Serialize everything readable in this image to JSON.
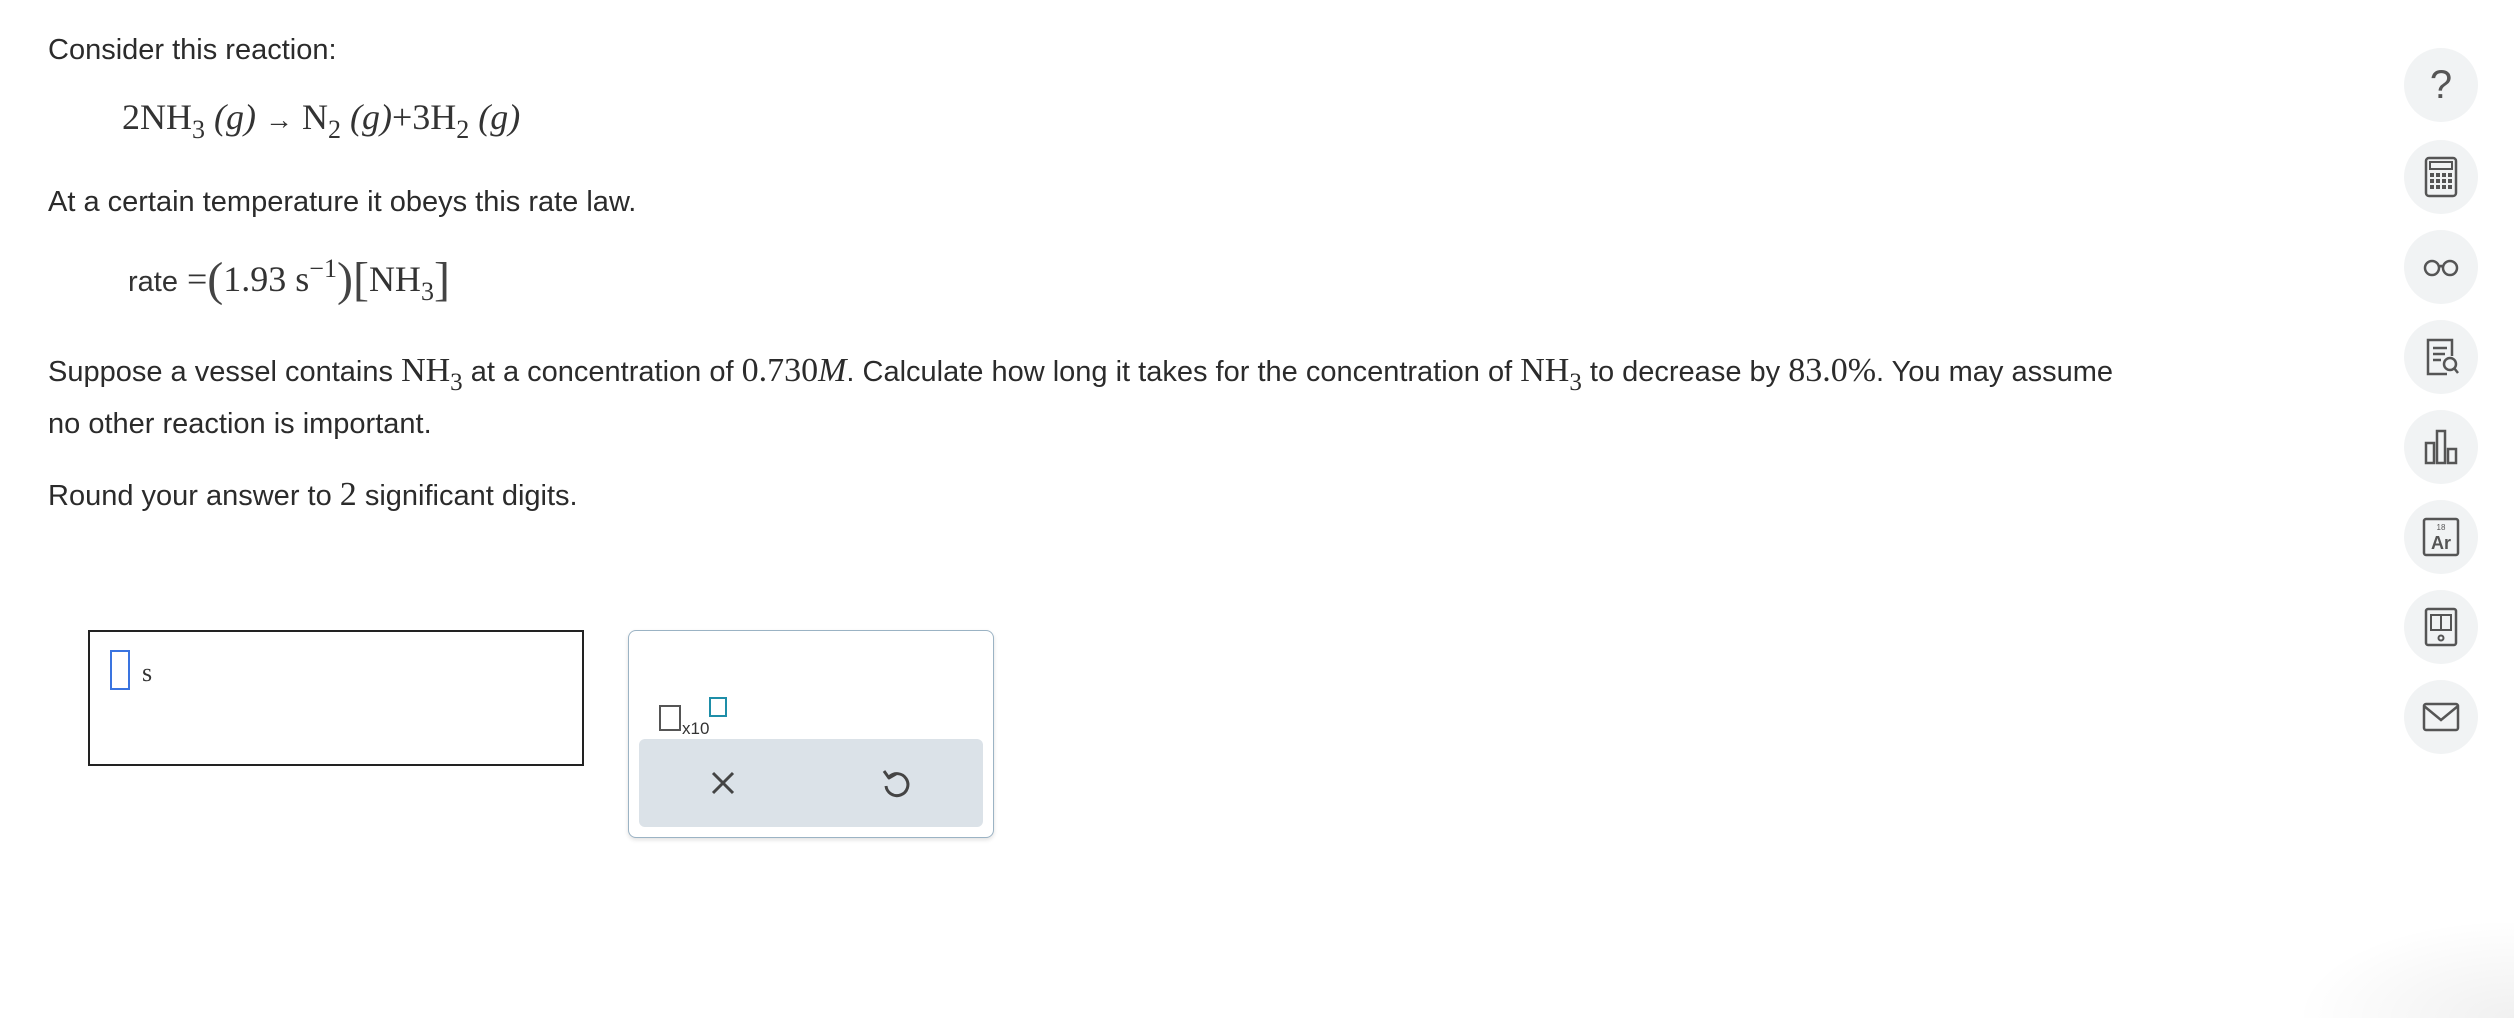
{
  "question": {
    "intro": "Consider this reaction:",
    "reaction": {
      "reactant_coef": "2",
      "reactant": "NH",
      "reactant_sub": "3",
      "phase1": "(g)",
      "arrow": "→",
      "product1": "N",
      "product1_sub": "2",
      "phase2": "(g)",
      "plus": "+",
      "product2_coef": "3",
      "product2": "H",
      "product2_sub": "2",
      "phase3": "(g)"
    },
    "rate_intro": "At a certain temperature it obeys this rate law.",
    "rate_law": {
      "label": "rate",
      "equals": "=",
      "k_value": "1.93 s",
      "k_exp": "−1",
      "species": "NH",
      "species_sub": "3"
    },
    "body": {
      "t1": "Suppose a vessel contains ",
      "species": "NH",
      "species_sub": "3",
      "t2": " at a concentration of ",
      "conc": "0.730",
      "conc_unit": "M",
      "t3": ". Calculate how long it takes for the concentration of ",
      "t4": " to decrease by ",
      "percent": "83.0%",
      "t5": ". You may assume",
      "line2": "no other reaction is important."
    },
    "round": {
      "t1": "Round your answer to ",
      "digits": "2",
      "t2": " significant digits."
    }
  },
  "answer": {
    "value": "",
    "unit": "s"
  },
  "tool_panel": {
    "x10_label": "x10",
    "clear_icon": "close-icon",
    "undo_icon": "undo-icon"
  },
  "sidebar": {
    "items": [
      "help-icon",
      "calculator-icon",
      "glasses-icon",
      "report-icon",
      "bar-chart-icon",
      "periodic-table-icon",
      "book-icon",
      "mail-icon"
    ],
    "help_label": "?",
    "periodic_number": "18",
    "periodic_symbol": "Ar"
  },
  "colors": {
    "cursor": "#3a74e0",
    "exponent_box": "#1e8ea8",
    "tool_bar": "#dbe2e8",
    "side_button": "#f1f3f4"
  }
}
